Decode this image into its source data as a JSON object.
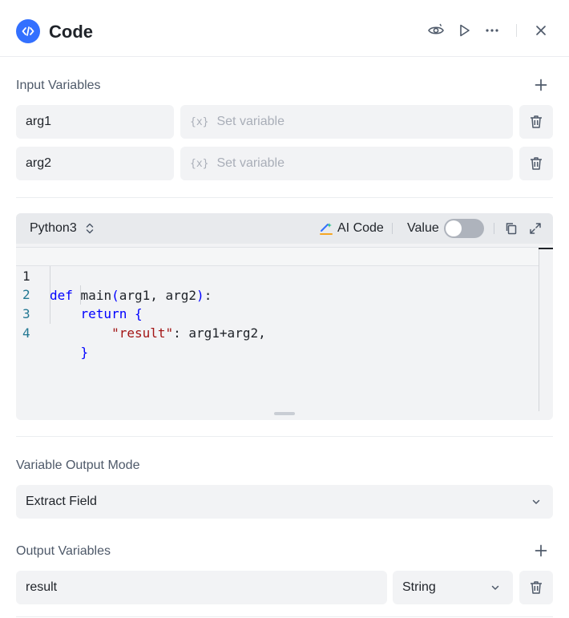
{
  "header": {
    "title": "Code",
    "logo_icon": "code-icon",
    "accent": "#3370ff",
    "actions": [
      "eye-icon",
      "play-icon",
      "more-icon",
      "close-icon"
    ]
  },
  "input_variables": {
    "label": "Input Variables",
    "rows": [
      {
        "name": "arg1",
        "value_tag": "{x}",
        "value_placeholder": "Set variable"
      },
      {
        "name": "arg2",
        "value_tag": "{x}",
        "value_placeholder": "Set variable"
      }
    ]
  },
  "code_editor": {
    "language": "Python3",
    "ai_code_label": "AI Code",
    "value_label": "Value",
    "value_toggle_on": false,
    "line_numbers": [
      "1",
      "2",
      "3",
      "4"
    ]
  },
  "output_mode": {
    "label": "Variable Output Mode",
    "selected": "Extract Field"
  },
  "output_variables": {
    "label": "Output Variables",
    "rows": [
      {
        "name": "result",
        "type": "String"
      }
    ]
  }
}
